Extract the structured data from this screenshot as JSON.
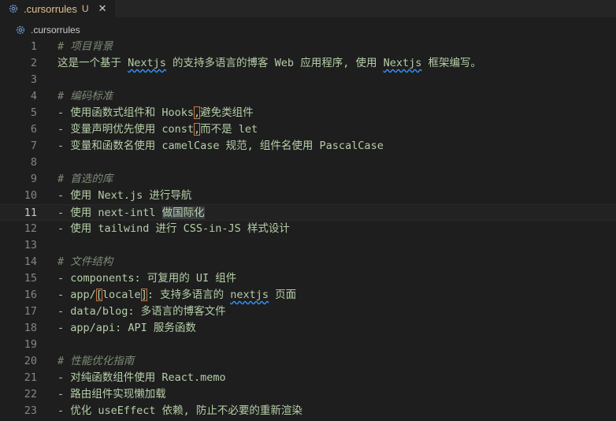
{
  "tab": {
    "filename": ".cursorrules",
    "status": "U",
    "close": "✕",
    "icon": "gear-icon"
  },
  "breadcrumb": {
    "filename": ".cursorrules",
    "icon": "gear-icon"
  },
  "colors": {
    "text": "#b5cea8",
    "comment": "#7c8b77",
    "modified": "#e2c08d",
    "spell": "#3794ff"
  },
  "editor": {
    "active_line": 11,
    "lines": [
      {
        "n": "1",
        "type": "comment",
        "text": "# 项目背景"
      },
      {
        "n": "2",
        "type": "text",
        "segments": [
          {
            "t": "这是一个基于 "
          },
          {
            "t": "Nextjs",
            "sq": true
          },
          {
            "t": " 的支持多语言的博客 Web 应用程序, 使用 "
          },
          {
            "t": "Nextjs",
            "sq": true
          },
          {
            "t": " 框架编写。"
          }
        ]
      },
      {
        "n": "3",
        "type": "empty"
      },
      {
        "n": "4",
        "type": "comment",
        "text": "# 编码标准"
      },
      {
        "n": "5",
        "type": "text",
        "segments": [
          {
            "t": "- 使用函数式组件和 Hooks"
          },
          {
            "t": ",",
            "box": true
          },
          {
            "t": "避免类组件"
          }
        ]
      },
      {
        "n": "6",
        "type": "text",
        "segments": [
          {
            "t": "- 变量声明优先使用 const"
          },
          {
            "t": ",",
            "box": true
          },
          {
            "t": "而不是 let"
          }
        ]
      },
      {
        "n": "7",
        "type": "text",
        "segments": [
          {
            "t": "- 变量和函数名使用 camelCase 规范, 组件名使用 PascalCase"
          }
        ]
      },
      {
        "n": "8",
        "type": "empty"
      },
      {
        "n": "9",
        "type": "comment",
        "text": "# 首选的库"
      },
      {
        "n": "10",
        "type": "text",
        "segments": [
          {
            "t": "- 使用 Next.js 进行导航"
          }
        ]
      },
      {
        "n": "11",
        "type": "text",
        "segments": [
          {
            "t": "- 使用 next-intl "
          },
          {
            "t": "做国际化",
            "hl": true
          }
        ]
      },
      {
        "n": "12",
        "type": "text",
        "segments": [
          {
            "t": "- 使用 tailwind 进行 CSS-in-JS 样式设计"
          }
        ]
      },
      {
        "n": "13",
        "type": "empty"
      },
      {
        "n": "14",
        "type": "comment",
        "text": "# 文件结构"
      },
      {
        "n": "15",
        "type": "text",
        "segments": [
          {
            "t": "- components: 可复用的 UI 组件"
          }
        ]
      },
      {
        "n": "16",
        "type": "text",
        "segments": [
          {
            "t": "- app/"
          },
          {
            "t": "[",
            "box": true
          },
          {
            "t": "locale"
          },
          {
            "t": "]",
            "box": true
          },
          {
            "t": ": 支持多语言的 "
          },
          {
            "t": "nextjs",
            "sq": true
          },
          {
            "t": " 页面"
          }
        ]
      },
      {
        "n": "17",
        "type": "text",
        "segments": [
          {
            "t": "- data/blog: 多语言的博客文件"
          }
        ]
      },
      {
        "n": "18",
        "type": "text",
        "segments": [
          {
            "t": "- app/api: API 服务函数"
          }
        ]
      },
      {
        "n": "19",
        "type": "empty"
      },
      {
        "n": "20",
        "type": "comment",
        "text": "# 性能优化指南"
      },
      {
        "n": "21",
        "type": "text",
        "segments": [
          {
            "t": "- 对纯函数组件使用 React.memo"
          }
        ]
      },
      {
        "n": "22",
        "type": "text",
        "segments": [
          {
            "t": "- 路由组件实现懒加载"
          }
        ]
      },
      {
        "n": "23",
        "type": "text",
        "segments": [
          {
            "t": "- 优化 useEffect 依赖, 防止不必要的重新渲染"
          }
        ]
      }
    ]
  }
}
